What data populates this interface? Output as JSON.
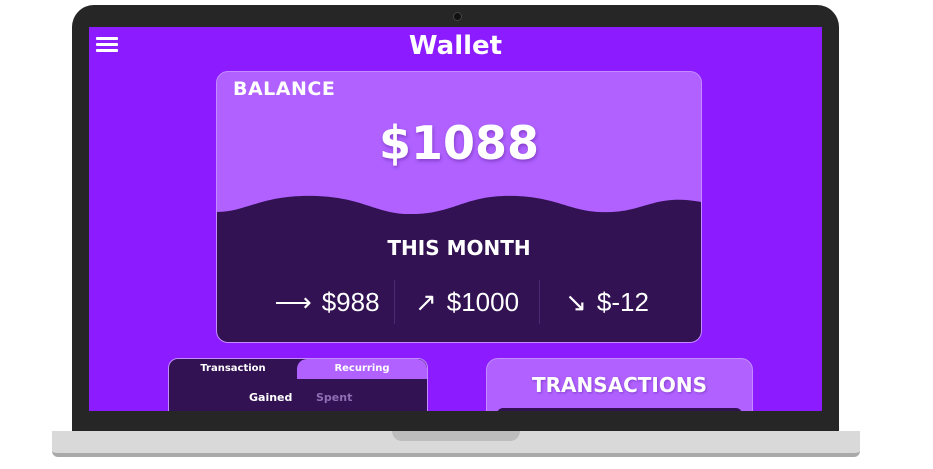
{
  "app": {
    "title": "Wallet"
  },
  "balance": {
    "label": "BALANCE",
    "amount": "$1088"
  },
  "this_month": {
    "title": "THIS MONTH",
    "stats": [
      {
        "icon": "right-arrow-icon",
        "arrow": "⟶",
        "value": "$988"
      },
      {
        "icon": "up-right-arrow-icon",
        "arrow": "↗",
        "value": "$1000"
      },
      {
        "icon": "down-right-arrow-icon",
        "arrow": "↘",
        "value": "$-12"
      }
    ]
  },
  "tabs": {
    "transaction": "Transaction",
    "recurring": "Recurring"
  },
  "subtabs": {
    "gained": "Gained",
    "spent": "Spent"
  },
  "transactions": {
    "title": "TRANSACTIONS"
  },
  "colors": {
    "background": "#8c1cff",
    "card_light": "#b061ff",
    "card_dark": "#321252"
  }
}
